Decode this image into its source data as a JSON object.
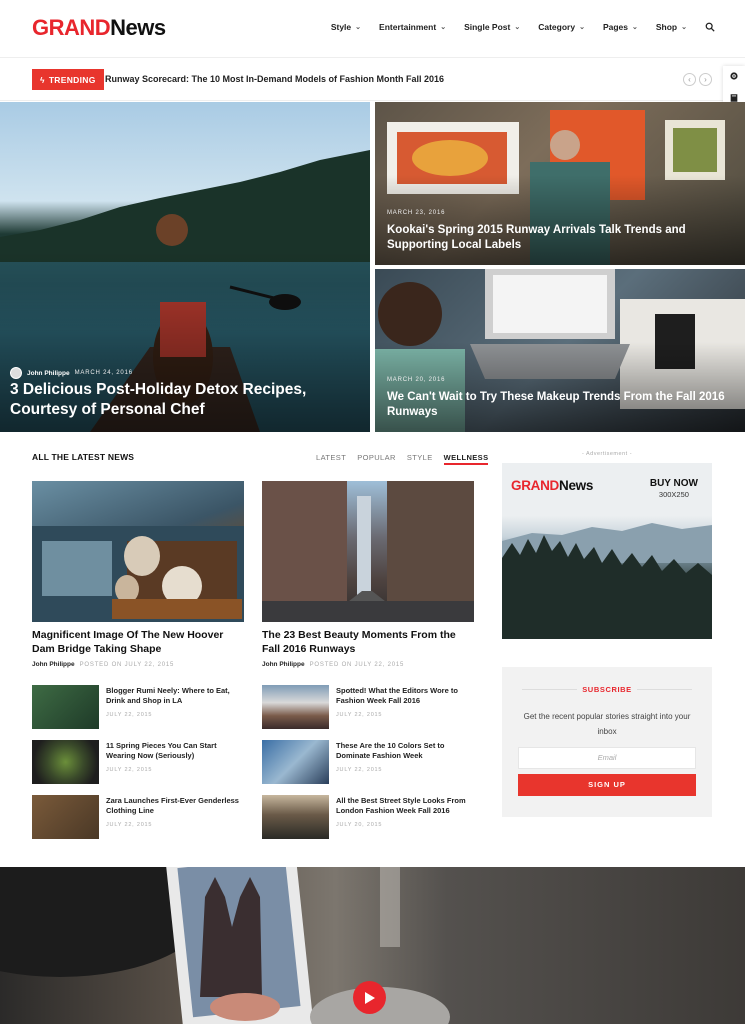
{
  "header": {
    "logo_part1": "GRAND",
    "logo_part2": "News",
    "nav": [
      {
        "label": "Style"
      },
      {
        "label": "Entertainment"
      },
      {
        "label": "Single Post"
      },
      {
        "label": "Category"
      },
      {
        "label": "Pages"
      },
      {
        "label": "Shop"
      }
    ],
    "search_icon": "search-icon"
  },
  "trending": {
    "badge": "TRENDING",
    "headline": "Runway Scorecard: The 10 Most In-Demand Models of Fashion Month Fall 2016"
  },
  "hero": {
    "main": {
      "author": "John Philippe",
      "date": "MARCH 24, 2016",
      "title": "3 Delicious Post-Holiday Detox Recipes, Courtesy of Personal Chef"
    },
    "side": [
      {
        "date": "MARCH 23, 2016",
        "title": "Kookai's Spring 2015 Runway Arrivals Talk Trends and Supporting Local Labels"
      },
      {
        "date": "MARCH 20, 2016",
        "title": "We Can't Wait to Try These Makeup Trends From the Fall 2016 Runways"
      }
    ]
  },
  "latest": {
    "section_title": "ALL THE LATEST NEWS",
    "tabs": [
      "LATEST",
      "POPULAR",
      "STYLE",
      "WELLNESS"
    ],
    "active_tab": "WELLNESS",
    "featured": [
      {
        "title": "Magnificent Image Of The New Hoover Dam Bridge Taking Shape",
        "author": "John Philippe",
        "date": "POSTED ON JULY 22, 2015"
      },
      {
        "title": "The 23 Best Beauty Moments From the Fall 2016 Runways",
        "author": "John Philippe",
        "date": "POSTED ON JULY 22, 2015"
      }
    ],
    "small_left": [
      {
        "title": "Blogger Rumi Neely: Where to Eat, Drink and Shop in LA",
        "date": "JULY 22, 2015"
      },
      {
        "title": "11 Spring Pieces You Can Start Wearing Now (Seriously)",
        "date": "JULY 22, 2015"
      },
      {
        "title": "Zara Launches First-Ever Genderless Clothing Line",
        "date": "JULY 22, 2015"
      }
    ],
    "small_right": [
      {
        "title": "Spotted! What the Editors Wore to Fashion Week Fall 2016",
        "date": "JULY 22, 2015"
      },
      {
        "title": "These Are the 10 Colors Set to Dominate Fashion Week",
        "date": "JULY 22, 2015"
      },
      {
        "title": "All the Best Street Style Looks From London Fashion Week Fall 2016",
        "date": "JULY 20, 2015"
      }
    ]
  },
  "sidebar": {
    "ad_label": "- Advertisement -",
    "ad_logo1": "GRAND",
    "ad_logo2": "News",
    "ad_buy": "BUY NOW",
    "ad_size": "300X250",
    "subscribe_title": "SUBSCRIBE",
    "subscribe_desc": "Get the recent popular stories straight into your inbox",
    "email_placeholder": "Email",
    "signup_label": "SIGN UP"
  },
  "colors": {
    "accent": "#e8262d",
    "text": "#222222"
  }
}
